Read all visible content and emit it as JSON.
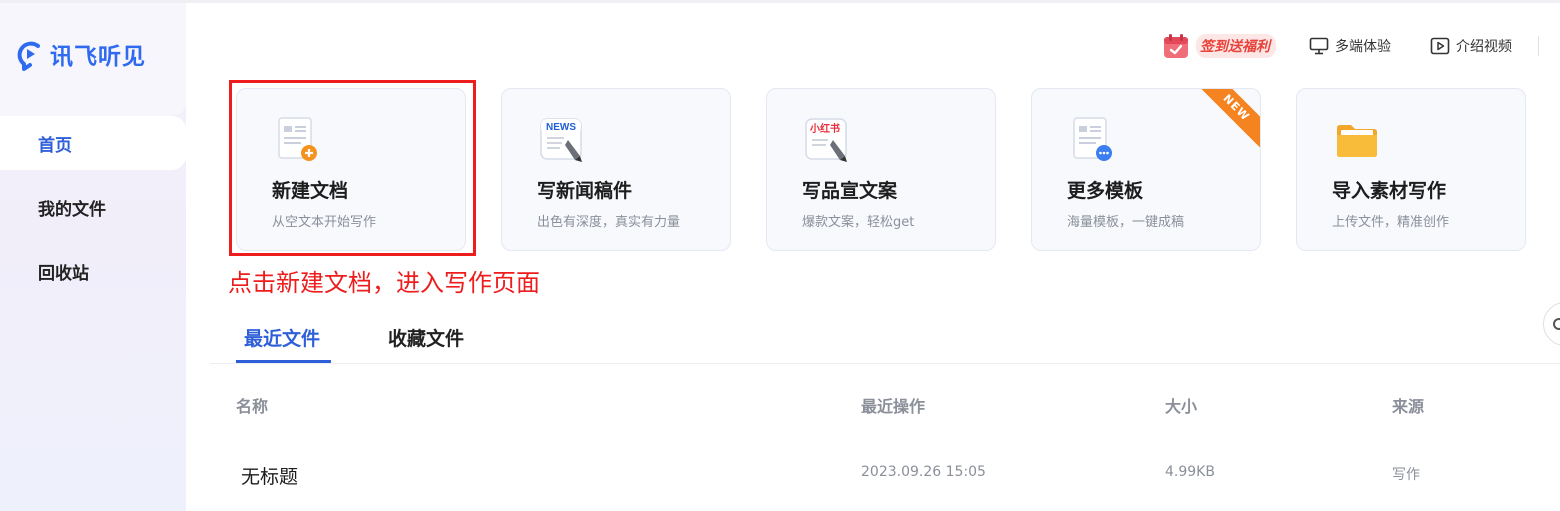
{
  "app": {
    "name": "讯飞听见"
  },
  "sidebar": {
    "items": [
      {
        "label": "首页",
        "active": true
      },
      {
        "label": "我的文件",
        "active": false
      },
      {
        "label": "回收站",
        "active": false
      }
    ]
  },
  "header": {
    "signin_label": "签到送福利",
    "multi_label": "多端体验",
    "video_label": "介绍视频"
  },
  "cards": [
    {
      "title": "新建文档",
      "subtitle": "从空文本开始写作",
      "icon": "new-document-icon"
    },
    {
      "title": "写新闻稿件",
      "subtitle": "出色有深度，真实有力量",
      "icon": "news-icon",
      "icon_text": "NEWS"
    },
    {
      "title": "写品宣文案",
      "subtitle": "爆款文案，轻松get",
      "icon": "xiaohongshu-icon",
      "icon_text": "小红书"
    },
    {
      "title": "更多模板",
      "subtitle": "海量模板，一键成稿",
      "icon": "template-icon",
      "badge": "NEW"
    },
    {
      "title": "导入素材写作",
      "subtitle": "上传文件，精准创作",
      "icon": "folder-icon"
    }
  ],
  "annotation": "点击新建文档，进入写作页面",
  "tabs": [
    {
      "label": "最近文件",
      "active": true
    },
    {
      "label": "收藏文件",
      "active": false
    }
  ],
  "table": {
    "headers": [
      "名称",
      "最近操作",
      "大小",
      "来源"
    ],
    "rows": [
      {
        "name": "无标题",
        "time": "2023.09.26 15:05",
        "size": "4.99KB",
        "source": "写作"
      }
    ]
  },
  "colors": {
    "accent": "#2f5fd8",
    "annotation": "#ee1d1d",
    "badge": "#f5831f",
    "signin": "#e8433a"
  }
}
